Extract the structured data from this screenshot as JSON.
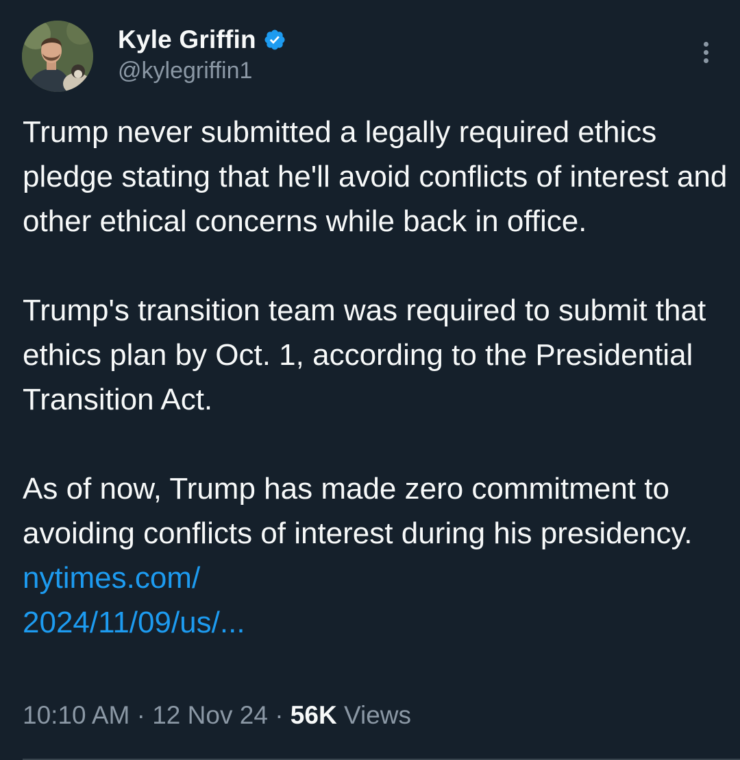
{
  "author": {
    "display_name": "Kyle Griffin",
    "handle": "@kylegriffin1",
    "verified": true,
    "avatar_icon": "profile-photo"
  },
  "menu": {
    "icon": "more-vertical-icon"
  },
  "tweet": {
    "paragraph_1": "Trump never submitted a legally required ethics pledge stating that he'll avoid conflicts of interest and other ethical concerns while back in office.",
    "paragraph_2": "Trump's transition team was required to submit that ethics plan by Oct. 1, according to the Presidential Transition Act.",
    "paragraph_3": "As of now, Trump has made zero commitment to avoiding conflicts of interest during his presidency.",
    "link_part_1": "nytimes.com/",
    "link_part_2": "2024/11/09/us/..."
  },
  "meta": {
    "time": "10:10 AM",
    "separator": "·",
    "date": "12 Nov 24",
    "views_count": "56K",
    "views_label": "Views"
  },
  "colors": {
    "background": "#15202b",
    "text": "#f7f9f9",
    "secondary": "#8b98a5",
    "accent": "#1d9bf0"
  }
}
